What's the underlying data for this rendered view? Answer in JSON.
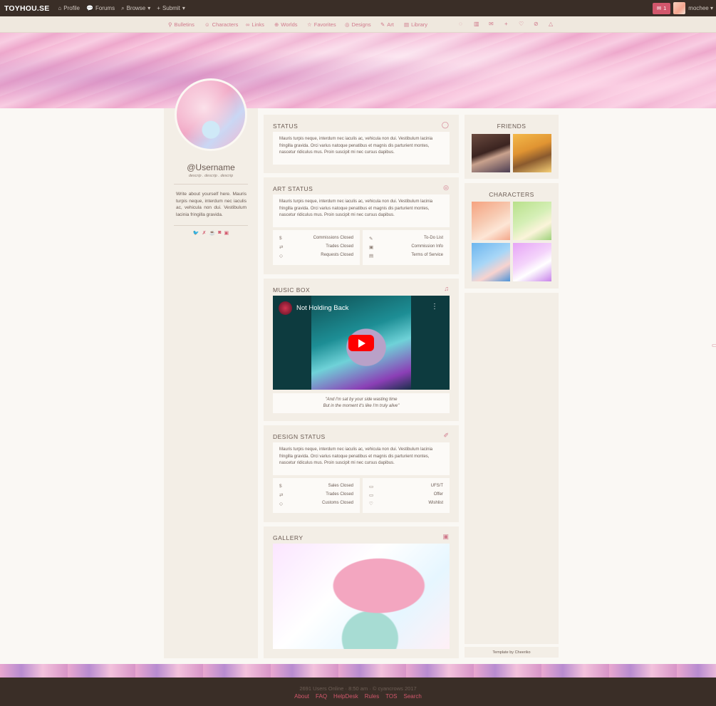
{
  "topnav": {
    "brand": "TOYHOU.SE",
    "items": [
      {
        "label": "Profile",
        "icon": "home-icon"
      },
      {
        "label": "Forums",
        "icon": "chat-bubbles-icon"
      },
      {
        "label": "Browse",
        "icon": "search-icon"
      },
      {
        "label": "Submit",
        "icon": "plus-icon"
      }
    ],
    "notifications": "1",
    "username": "mochee"
  },
  "subnav": {
    "items": [
      {
        "label": "Bulletins",
        "icon": "pin-icon"
      },
      {
        "label": "Characters",
        "icon": "users-icon"
      },
      {
        "label": "Links",
        "icon": "link-icon"
      },
      {
        "label": "Worlds",
        "icon": "globe-icon"
      },
      {
        "label": "Favorites",
        "icon": "star-icon"
      },
      {
        "label": "Designs",
        "icon": "palette-icon"
      },
      {
        "label": "Art",
        "icon": "pencil-icon"
      },
      {
        "label": "Library",
        "icon": "book-icon"
      }
    ],
    "action_icons": [
      "comment-icon",
      "stats-icon",
      "mail-icon",
      "add-icon",
      "heart-icon",
      "block-icon",
      "warning-icon"
    ]
  },
  "profile": {
    "username": "@Username",
    "descrip": "descrip . descrip . descrip",
    "bio": "Write about yourself here. Mauris turpis neque, interdum nec iaculis ac, vehicula non dui. Vestibulum lacinia fringilla gravida.",
    "socials": [
      "twitter-icon",
      "deviantart-icon",
      "kofi-icon",
      "instagram-icon",
      "tumblr-icon"
    ]
  },
  "status": {
    "title": "STATUS",
    "text": "Mauris turpis neque, interdum nec iaculis ac, vehicula non dui. Vestibulum lacinia fringilla gravida. Orci varius natoque penatibus et magnis dis parturient montes, nascetur ridiculus mus. Proin suscipit mi nec cursus dapibus."
  },
  "art_status": {
    "title": "ART STATUS",
    "text": "Mauris turpis neque, interdum nec iaculis ac, vehicula non dui. Vestibulum lacinia fringilla gravida. Orci varius natoque penatibus et magnis dis parturient montes, nascetur ridiculus mus. Proin suscipit mi nec cursus dapibus.",
    "left": [
      {
        "icon": "dollar-icon",
        "label": "Commissions Closed"
      },
      {
        "icon": "exchange-icon",
        "label": "Trades Closed"
      },
      {
        "icon": "tag-icon",
        "label": "Requests Closed"
      }
    ],
    "right": [
      {
        "icon": "pen-icon",
        "label": "To-Do List"
      },
      {
        "icon": "image-icon",
        "label": "Commission Info"
      },
      {
        "icon": "list-icon",
        "label": "Terms of Service"
      }
    ]
  },
  "music_box": {
    "title": "MUSIC BOX",
    "video_title": "Not Holding Back",
    "lyric1": "\"And I'm sat by your side wasting time",
    "lyric2": "But in the moment it's like I'm truly alive\""
  },
  "design_status": {
    "title": "DESIGN STATUS",
    "text": "Mauris turpis neque, interdum nec iaculis ac, vehicula non dui. Vestibulum lacinia fringilla gravida. Orci varius natoque penatibus et magnis dis parturient montes, nascetur ridiculus mus. Proin suscipit mi nec cursus dapibus.",
    "left": [
      {
        "icon": "dollar-icon",
        "label": "Sales Closed"
      },
      {
        "icon": "exchange-icon",
        "label": "Trades Closed"
      },
      {
        "icon": "tag-icon",
        "label": "Customs Closed"
      }
    ],
    "right": [
      {
        "icon": "folder-icon",
        "label": "UFS/T"
      },
      {
        "icon": "folder-icon",
        "label": "Offer"
      },
      {
        "icon": "heart-icon",
        "label": "Wishlist"
      }
    ]
  },
  "gallery": {
    "title": "GALLERY"
  },
  "friends": {
    "title": "FRIENDS"
  },
  "characters": {
    "title": "CHARACTERS"
  },
  "credit": "Template by Cheeriko",
  "footer": {
    "stats": "2691 Users Online · 8:50 am · © cyancrows 2017",
    "links": [
      "About",
      "FAQ",
      "HelpDesk",
      "Rules",
      "TOS",
      "Search"
    ]
  },
  "colors": {
    "accent": "#d2576c",
    "nav_bg": "#3a2e27",
    "panel_bg": "#f3eee6"
  }
}
